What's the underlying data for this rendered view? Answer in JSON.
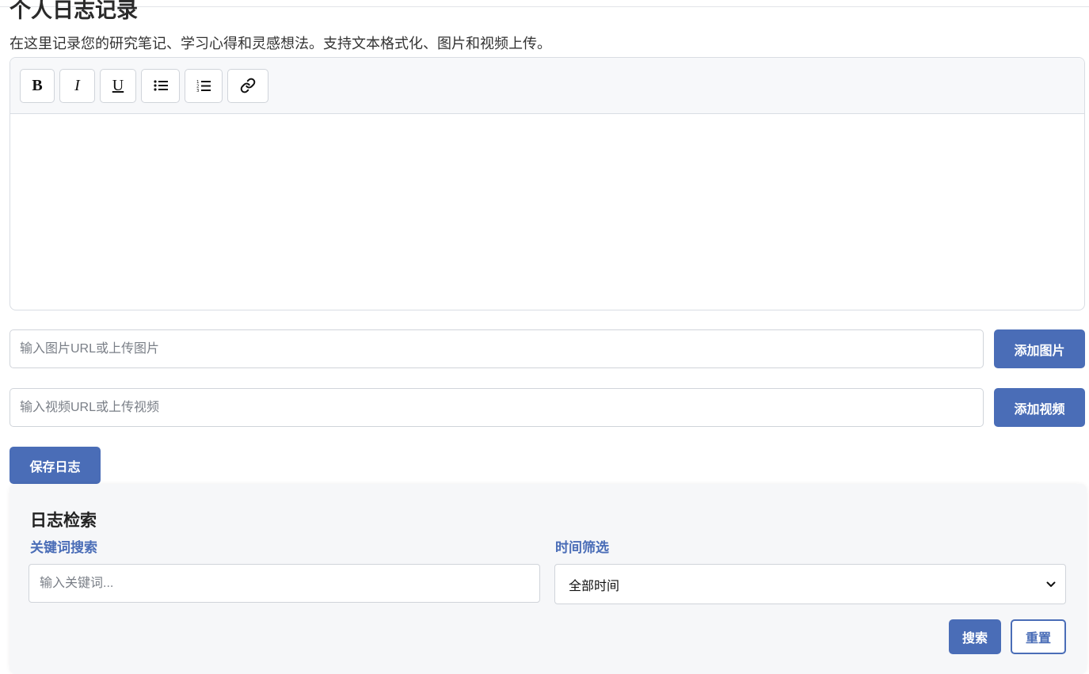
{
  "page": {
    "title": "个人日志记录",
    "subtitle": "在这里记录您的研究笔记、学习心得和灵感想法。支持文本格式化、图片和视频上传。"
  },
  "toolbar": {
    "bold": "B",
    "italic": "I",
    "underline": "U",
    "bullet_icon": "bulleted-list-icon",
    "numbered_icon": "numbered-list-icon",
    "link_icon": "link-icon"
  },
  "media": {
    "image_placeholder": "输入图片URL或上传图片",
    "image_button": "添加图片",
    "video_placeholder": "输入视频URL或上传视频",
    "video_button": "添加视频"
  },
  "save_button": "保存日志",
  "search": {
    "title": "日志检索",
    "keyword_label": "关键词搜索",
    "keyword_placeholder": "输入关键词...",
    "time_label": "时间筛选",
    "time_selected": "全部时间",
    "search_button": "搜索",
    "reset_button": "重置"
  },
  "colors": {
    "accent": "#4a6db7",
    "panel_bg": "#f6f7f9",
    "toolbar_bg": "#f7f8fa"
  }
}
